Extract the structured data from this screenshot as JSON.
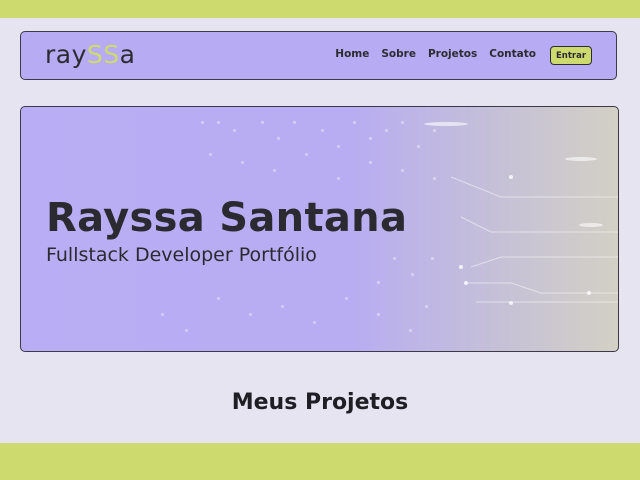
{
  "header": {
    "logo_prefix": "ray",
    "logo_accent": "SS",
    "logo_suffix": "a",
    "nav": [
      "Home",
      "Sobre",
      "Projetos",
      "Contato"
    ],
    "login_label": "Entrar"
  },
  "hero": {
    "title": "Rayssa Santana",
    "subtitle": "Fullstack Developer Portfólio"
  },
  "projects": {
    "title": "Meus Projetos"
  },
  "colors": {
    "accent": "#cddb6e",
    "primary": "#b7abf3",
    "background": "#e7e4f1",
    "text": "#2d2c33"
  }
}
